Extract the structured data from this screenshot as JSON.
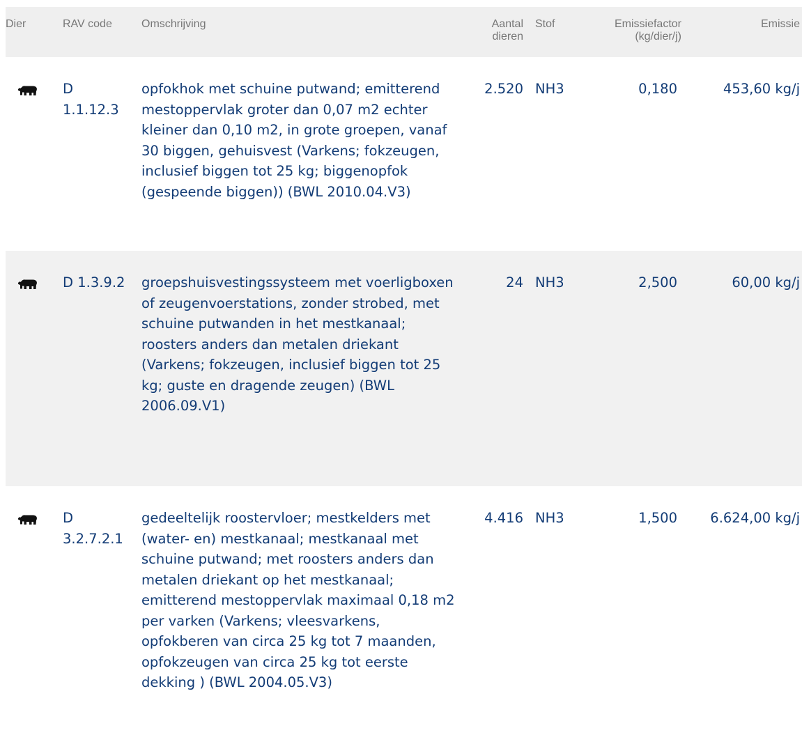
{
  "header": {
    "dier": "Dier",
    "rav_code": "RAV code",
    "omschrijving": "Omschrijving",
    "aantal_line1": "Aantal",
    "aantal_line2": "dieren",
    "stof": "Stof",
    "factor_line1": "Emissiefactor",
    "factor_line2": "(kg/dier/j)",
    "emissie": "Emissie"
  },
  "rows": [
    {
      "icon": "pig-icon",
      "rav_code": "D 1.1.12.3",
      "omschrijving": "opfokhok met schuine putwand; emitterend mestoppervlak groter dan 0,07 m2 echter kleiner dan 0,10 m2, in grote groepen, vanaf 30 biggen, gehuisvest  (Varkens; fokzeugen, inclusief biggen tot 25 kg; biggenopfok (gespeende biggen)) (BWL 2010.04.V3)",
      "aantal": "2.520",
      "stof": "NH3",
      "factor": "0,180",
      "emissie": "453,60 kg/j"
    },
    {
      "icon": "pig-icon",
      "rav_code": "D 1.3.9.2",
      "omschrijving": "groepshuisvestingssysteem met voerligboxen of zeugenvoerstations, zonder strobed, met schuine putwanden in het mestkanaal; roosters anders dan metalen driekant  (Varkens; fokzeugen, inclusief biggen tot 25 kg; guste en dragende zeugen) (BWL 2006.09.V1)",
      "aantal": "24",
      "stof": "NH3",
      "factor": "2,500",
      "emissie": "60,00 kg/j"
    },
    {
      "icon": "pig-icon",
      "rav_code": "D 3.2.7.2.1",
      "omschrijving": "gedeeltelijk roostervloer; mestkelders met (water- en) mestkanaal; mestkanaal met schuine putwand; met roosters anders dan metalen driekant op het mestkanaal; emitterend mestoppervlak maximaal 0,18 m2 per varken  (Varkens; vleesvarkens, opfokberen van circa 25 kg tot 7 maanden, opfokzeugen van circa 25 kg tot eerste dekking ) (BWL 2004.05.V3)",
      "aantal": "4.416",
      "stof": "NH3",
      "factor": "1,500",
      "emissie": "6.624,00 kg/j"
    }
  ]
}
